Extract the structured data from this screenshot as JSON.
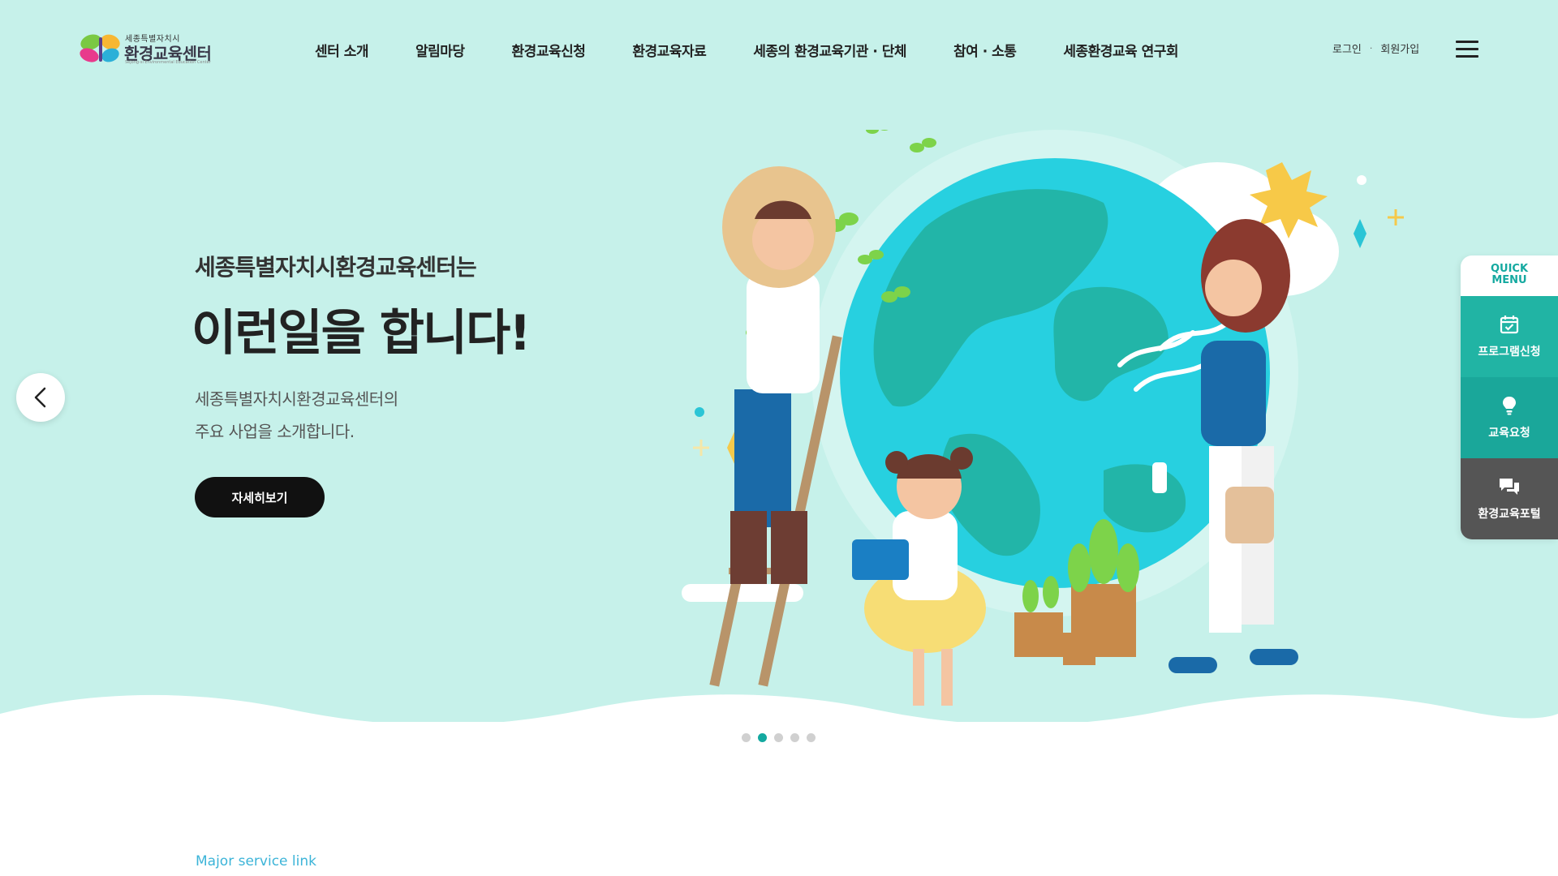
{
  "logo": {
    "small_text": "세종특별자치시",
    "main_text": "환경교육센터",
    "sub_text": "Sejong-si Environmental Education Center"
  },
  "nav": {
    "items": [
      "센터 소개",
      "알림마당",
      "환경교육신청",
      "환경교육자료",
      "세종의 환경교육기관 · 단체",
      "참여 · 소통",
      "세종환경교육 연구회"
    ]
  },
  "util": {
    "login": "로그인",
    "separator": "·",
    "signup": "회원가입"
  },
  "hero": {
    "subtitle": "세종특별자치시환경교육센터는",
    "title": "이런일을 합니다!",
    "desc_line1": "세종특별자치시환경교육센터의",
    "desc_line2": "주요 사업을 소개합니다.",
    "button": "자세히보기"
  },
  "slider": {
    "total": 5,
    "active_index": 1
  },
  "quick_menu": {
    "title_line1": "QUICK",
    "title_line2": "MENU",
    "items": [
      {
        "label": "프로그램신청",
        "icon": "calendar-check-icon"
      },
      {
        "label": "교육요청",
        "icon": "lightbulb-icon"
      },
      {
        "label": "환경교육포털",
        "icon": "chat-bubble-icon"
      }
    ]
  },
  "section": {
    "label": "Major service link"
  },
  "colors": {
    "hero_bg": "#c6f1ea",
    "accent": "#14a9a0",
    "quick_teal": "#21b4a4",
    "quick_dark": "#555555",
    "section_label": "#3cb4d8"
  }
}
